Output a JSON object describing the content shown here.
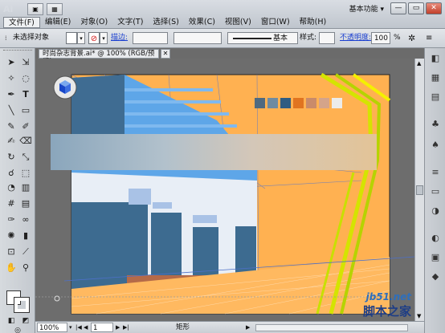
{
  "app": {
    "logo": "Ai"
  },
  "menu": [
    "文件(F)",
    "编辑(E)",
    "对象(O)",
    "文字(T)",
    "选择(S)",
    "效果(C)",
    "视图(V)",
    "窗口(W)",
    "帮助(H)"
  ],
  "workspace": "基本功能 ▾",
  "window_controls": {
    "minimize": "—",
    "restore": "▭",
    "close": "✕"
  },
  "controlbar": {
    "selection": "未选择对象",
    "stroke_label": "描边:",
    "brush_label": "基本",
    "style_label": "样式:",
    "opacity_label": "不透明度:",
    "opacity_value": "100",
    "percent": "%"
  },
  "doc_tab": {
    "title": "时尚杂志背景.ai* @ 100% (RGB/预览)",
    "close": "✕"
  },
  "statusbar": {
    "zoom": "100%",
    "page": "1",
    "tool": "矩形"
  },
  "palette": [
    "#4f6a80",
    "#6f8ba1",
    "#2f5c82",
    "#e07420",
    "#c98b6a",
    "#d4a48a",
    "#ececea"
  ],
  "watermark": {
    "line1": "jb51.net",
    "line2": "脚本之家"
  }
}
